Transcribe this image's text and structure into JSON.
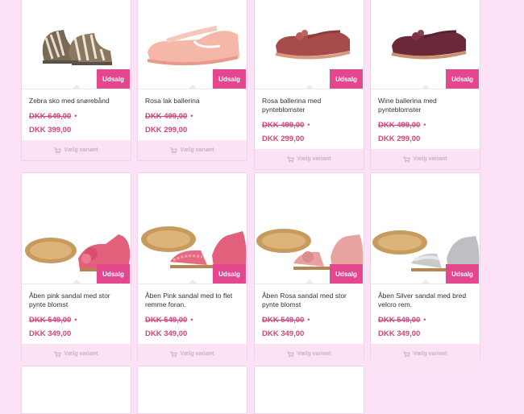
{
  "colors": {
    "page_bg": "#fce1f7",
    "accent": "#e5478f",
    "button_bg": "#fbe3f4"
  },
  "products": [
    {
      "name": "Zebra sko med snørebånd",
      "old_price": "DKK 649,00",
      "new_price": "DKK 399,00",
      "badge": "Udsalg",
      "button": "Vælg variant",
      "icon": "cart-icon"
    },
    {
      "name": "Rosa lak ballerina",
      "old_price": "DKK 499,00",
      "new_price": "DKK 299,00",
      "badge": "Udsalg",
      "button": "Vælg variant",
      "icon": "cart-icon"
    },
    {
      "name": "Rosa ballerina med pynteblomster",
      "old_price": "DKK 499,00",
      "new_price": "DKK 299,00",
      "badge": "Udsalg",
      "button": "Vælg variant",
      "icon": "cart-icon"
    },
    {
      "name": "Wine ballerina med pynteblomster",
      "old_price": "DKK 499,00",
      "new_price": "DKK 299,00",
      "badge": "Udsalg",
      "button": "Vælg variant",
      "icon": "cart-icon"
    },
    {
      "name": "Åben pink sandal med stor pynte blomst",
      "old_price": "DKK 549,00",
      "new_price": "DKK 349,00",
      "badge": "Udsalg",
      "button": "Vælg variant",
      "icon": "cart-icon"
    },
    {
      "name": "Åben Pink sandal med to flet remme foran.",
      "old_price": "DKK 549,00",
      "new_price": "DKK 349,00",
      "badge": "Udsalg",
      "button": "Vælg variant",
      "icon": "cart-icon"
    },
    {
      "name": "Åben Rosa sandal med stor pynte blomst",
      "old_price": "DKK 549,00",
      "new_price": "DKK 349,00",
      "badge": "Udsalg",
      "button": "Vælg variant",
      "icon": "cart-icon"
    },
    {
      "name": "Åben Silver sandal med bred velcro rem.",
      "old_price": "DKK 549,00",
      "new_price": "DKK 349,00",
      "badge": "Udsalg",
      "button": "Vælg variant",
      "icon": "cart-icon"
    }
  ],
  "price_separator": "•"
}
